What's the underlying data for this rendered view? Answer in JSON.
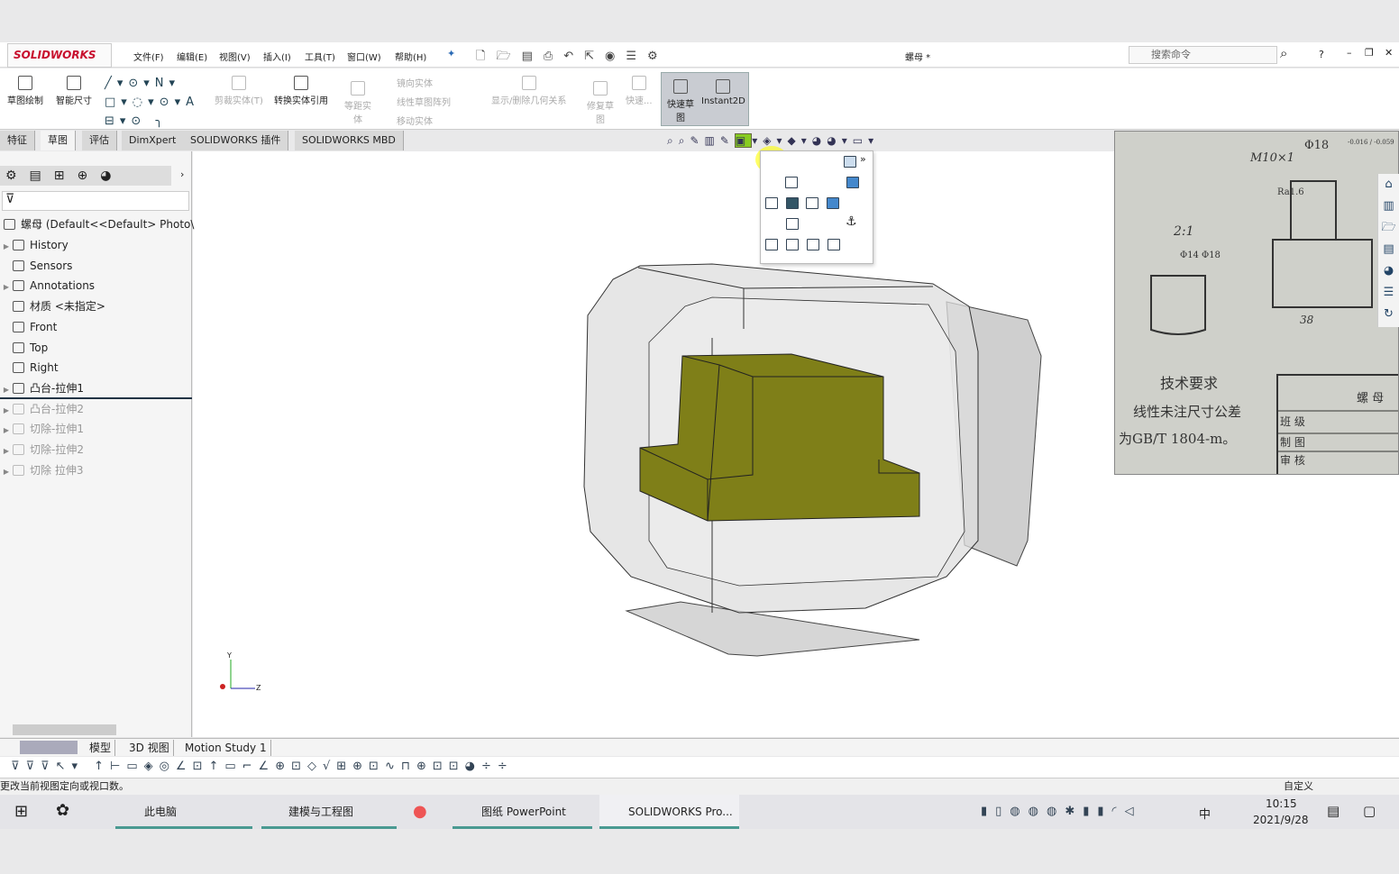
{
  "app": {
    "logo": "SOLIDWORKS",
    "document_title": "螺母 *",
    "search_placeholder": "搜索命令"
  },
  "menu": [
    "文件(F)",
    "编辑(E)",
    "视图(V)",
    "插入(I)",
    "工具(T)",
    "窗口(W)",
    "帮助(H)"
  ],
  "ribbon": {
    "sketch": "草图绘制",
    "smart_dim": "智能尺寸",
    "trim": "剪裁实体(T)",
    "convert": "转换实体引用",
    "offset": "等距实体",
    "mirror": "镜向实体",
    "linear_pattern": "线性草图阵列",
    "move": "移动实体",
    "relations": "显示/删除几何关系",
    "repair": "修复草图",
    "quick_snaps": "快速...",
    "rapid_sketch": "快速草图",
    "instant2d": "Instant2D"
  },
  "command_tabs": [
    {
      "label": "特征",
      "active": false
    },
    {
      "label": "草图",
      "active": true
    },
    {
      "label": "评估",
      "active": false
    },
    {
      "label": "DimXpert",
      "active": false
    },
    {
      "label": "SOLIDWORKS 插件",
      "active": false
    },
    {
      "label": "SOLIDWORKS MBD",
      "active": false
    }
  ],
  "tree": {
    "root": "螺母 (Default<<Default> Photo\\",
    "items": [
      {
        "label": "History",
        "icon": "history-folder-icon",
        "expandable": true,
        "suppressed": false
      },
      {
        "label": "Sensors",
        "icon": "sensors-folder-icon",
        "expandable": false,
        "suppressed": false
      },
      {
        "label": "Annotations",
        "icon": "annotations-icon",
        "expandable": true,
        "suppressed": false
      },
      {
        "label": "材质 <未指定>",
        "icon": "material-icon",
        "expandable": false,
        "suppressed": false
      },
      {
        "label": "Front",
        "icon": "plane-icon",
        "expandable": false,
        "suppressed": false
      },
      {
        "label": "Top",
        "icon": "plane-icon",
        "expandable": false,
        "suppressed": false
      },
      {
        "label": "Right",
        "icon": "plane-icon",
        "expandable": false,
        "suppressed": false
      },
      {
        "label": "凸台-拉伸1",
        "icon": "boss-extrude-icon",
        "expandable": true,
        "suppressed": false
      },
      {
        "label": "凸台-拉伸2",
        "icon": "boss-extrude-icon",
        "expandable": true,
        "suppressed": true
      },
      {
        "label": "切除-拉伸1",
        "icon": "cut-extrude-icon",
        "expandable": true,
        "suppressed": true
      },
      {
        "label": "切除-拉伸2",
        "icon": "cut-extrude-icon",
        "expandable": true,
        "suppressed": true
      },
      {
        "label": "切除 拉伸3",
        "icon": "cut-extrude-icon",
        "expandable": true,
        "suppressed": true
      }
    ]
  },
  "drawing_photo": {
    "dim1": "Φ18",
    "tol": "-0.016 / -0.059",
    "thread": "M10×1",
    "scale": "2:1",
    "d14": "Φ14",
    "d18": "Φ18",
    "h18": "18",
    "w38": "38",
    "ra": "Ra1.6",
    "req_title": "技术要求",
    "req1": "线性未注尺寸公差",
    "req2": "为GB/T 1804-m。",
    "part": "螺 母",
    "class": "班 级",
    "drawn": "制 图",
    "checked": "审 核"
  },
  "triad": {
    "y": "Y",
    "z": "Z"
  },
  "bottom_tabs": [
    "模型",
    "3D 视图",
    "Motion Study 1"
  ],
  "status": {
    "message": "更改当前视图定向或视口数。",
    "units": "自定义"
  },
  "taskbar": {
    "items": [
      "此电脑",
      "建模与工程图",
      "图纸 PowerPoint",
      "SOLIDWORKS Pro..."
    ],
    "time": "10:15",
    "date": "2021/9/28",
    "ime": "中"
  },
  "colors": {
    "model_body": "#7f7f18",
    "accent": "#c8102e",
    "taskbar_underline": "#4a9a92"
  }
}
